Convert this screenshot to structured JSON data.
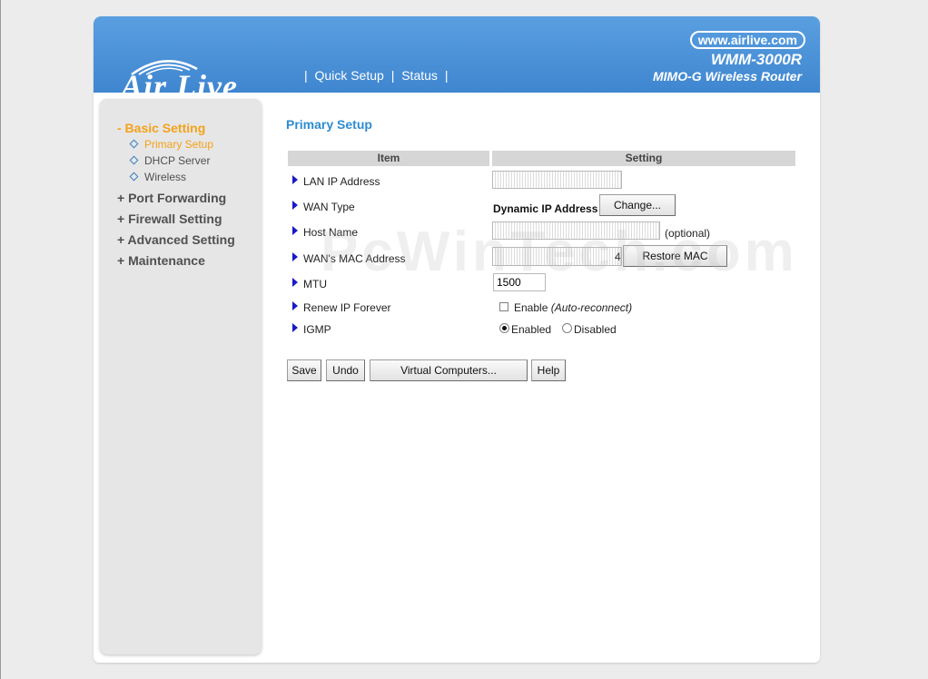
{
  "brand": {
    "logo_text": "Air Live",
    "url": "www.airlive.com",
    "model": "WMM-3000R",
    "subtitle": "MIMO-G Wireless Router",
    "header_color": "#4a93db"
  },
  "nav": {
    "sep": "|",
    "items": [
      "Quick Setup",
      "Status"
    ]
  },
  "sidebar": {
    "basic": "- Basic Setting",
    "sub": [
      "Primary Setup",
      "DHCP Server",
      "Wireless"
    ],
    "items": [
      "+ Port Forwarding",
      "+ Firewall Setting",
      "+ Advanced Setting",
      "+ Maintenance"
    ],
    "active_color": "#f4a21a"
  },
  "main": {
    "title": "Primary Setup",
    "table_header": {
      "item": "Item",
      "setting": "Setting"
    },
    "rows": {
      "lan_ip": {
        "label": "LAN IP Address"
      },
      "wan_type": {
        "label": "WAN Type",
        "value": "Dynamic IP Address",
        "button": "Change..."
      },
      "host_name": {
        "label": "Host Name",
        "note": "(optional)"
      },
      "wan_mac": {
        "label": "WAN's MAC Address",
        "visible_suffix": "4",
        "button": "Restore MAC"
      },
      "mtu": {
        "label": "MTU",
        "value": "1500"
      },
      "renew": {
        "label": "Renew IP Forever",
        "option": "Enable",
        "option_note": "(Auto-reconnect)",
        "checked": false
      },
      "igmp": {
        "label": "IGMP",
        "enabled": "Enabled",
        "disabled": "Disabled",
        "selected": "Enabled"
      }
    },
    "buttons": {
      "save": "Save",
      "undo": "Undo",
      "virtual": "Virtual Computers...",
      "help": "Help"
    }
  },
  "watermark": "PcWinTech.com"
}
